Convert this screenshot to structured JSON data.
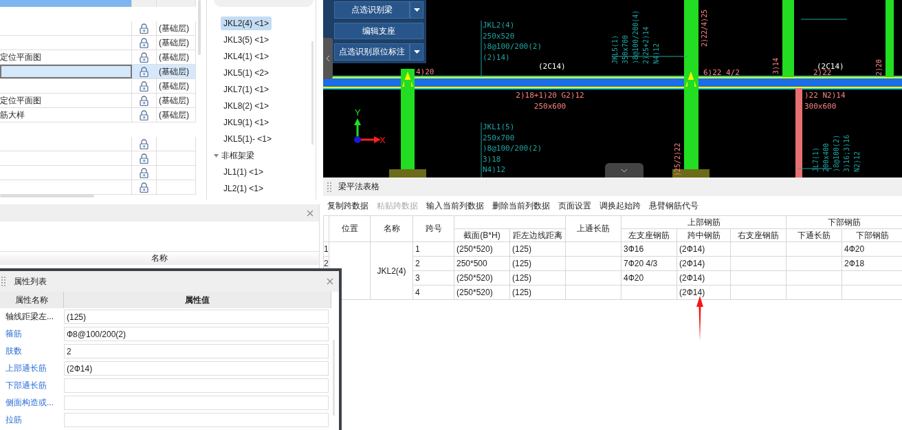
{
  "layer_table": {
    "rows": [
      {
        "kind": "spacer"
      },
      {
        "kind": "entry",
        "floor": "(基础层)",
        "selected": false
      },
      {
        "kind": "entry",
        "floor": "(基础层)",
        "selected": false
      },
      {
        "kind": "entry",
        "name": "定位平面图",
        "floor": "(基础层)",
        "selected": false
      },
      {
        "kind": "entry",
        "floor": "(基础层)",
        "selected": true
      },
      {
        "kind": "entry",
        "floor": "(基础层)",
        "selected": false
      },
      {
        "kind": "entry",
        "name": "定位平面图",
        "floor": "(基础层)",
        "selected": false
      },
      {
        "kind": "entry",
        "name": "筋大样",
        "floor": "(基础层)",
        "selected": false
      },
      {
        "kind": "spacer"
      },
      {
        "kind": "entry",
        "selected": false
      },
      {
        "kind": "entry",
        "selected": false
      },
      {
        "kind": "entry",
        "selected": false
      },
      {
        "kind": "entry",
        "selected": false
      }
    ]
  },
  "component_tree": [
    {
      "kind": "item",
      "label": "JKL2(4) <1>",
      "selected": true
    },
    {
      "kind": "item",
      "label": "JKL3(5) <1>",
      "selected": false
    },
    {
      "kind": "item",
      "label": "JKL4(1) <1>",
      "selected": false
    },
    {
      "kind": "item",
      "label": "JKL5(1) <2>",
      "selected": false
    },
    {
      "kind": "item",
      "label": "JKL7(1) <1>",
      "selected": false
    },
    {
      "kind": "item",
      "label": "JKL8(2) <1>",
      "selected": false
    },
    {
      "kind": "item",
      "label": "JKL9(1) <1>",
      "selected": false
    },
    {
      "kind": "item",
      "label": "JKL5(1)- <1>",
      "selected": false
    },
    {
      "kind": "group",
      "label": "非框架梁",
      "expanded": true,
      "selected": false,
      "children": [
        {
          "kind": "item",
          "label": "JL1(1) <1>",
          "selected": false
        },
        {
          "kind": "item",
          "label": "JL2(1) <1>",
          "selected": false
        }
      ]
    }
  ],
  "lower_panel": {
    "column": "名称"
  },
  "cad": {
    "toolbar": [
      {
        "label": "点选识别梁",
        "dropdown": true
      },
      {
        "label": "编辑支座",
        "dropdown": false
      },
      {
        "label": "点选识别原位标注",
        "dropdown": true
      }
    ],
    "axis": {
      "x": "X",
      "y": "Y"
    },
    "labels": [
      {
        "lines": [
          "JKL2(4)",
          "250x520",
          ")8@100/200(2)",
          "(2)14)"
        ],
        "color": "#1fa5a5",
        "rotated": false
      },
      {
        "lines": [
          "(2C14)"
        ],
        "color": "#ffffff",
        "rotated": false
      },
      {
        "lines": [
          "4)20"
        ],
        "color": "#ff8080",
        "rotated": false
      },
      {
        "lines": [
          "2)18+1)20 G2)12",
          "250x600"
        ],
        "color": "#ff8080",
        "rotated": false
      },
      {
        "lines": [
          "JKL5(1)",
          "350x700",
          ")8@100/200(4)",
          "2)25+2)14",
          "N4)12"
        ],
        "color": "#1fa5a5",
        "rotated": true
      },
      {
        "lines": [
          "2)22/4)25"
        ],
        "color": "#ff8080",
        "rotated": true
      },
      {
        "lines": [
          "6)22 4/2"
        ],
        "color": "#ff8080",
        "rotated": false
      },
      {
        "lines": [
          "3)14"
        ],
        "color": "#ff8080",
        "rotated": true
      },
      {
        "lines": [
          "(2C14)"
        ],
        "color": "#ffffff",
        "rotated": false
      },
      {
        "lines": [
          "2)22"
        ],
        "color": "#ff8080",
        "rotated": false
      },
      {
        "lines": [
          "2)20"
        ],
        "color": "#ff8080",
        "rotated": true
      },
      {
        "lines": [
          ")22 N2)14",
          "300x600"
        ],
        "color": "#ff8080",
        "rotated": false
      },
      {
        "lines": [
          "JKL1(5)",
          "250x700",
          ")8@100/200(2)",
          "3)18",
          "N4)12"
        ],
        "color": "#1fa5a5",
        "rotated": false
      },
      {
        "lines": [
          ")25/2)22"
        ],
        "color": "#ff8080",
        "rotated": true
      },
      {
        "lines": [
          "JL7(1)",
          "200x400",
          ")8@100(2)",
          "3)16;3)16",
          "N2)12"
        ],
        "color": "#1fa5a5",
        "rotated": true
      }
    ]
  },
  "beam_table": {
    "title": "梁平法表格",
    "toolbar": [
      {
        "label": "复制跨数据",
        "disabled": false
      },
      {
        "label": "粘贴跨数据",
        "disabled": true
      },
      {
        "label": "输入当前列数据",
        "disabled": false
      },
      {
        "label": "删除当前列数据",
        "disabled": false
      },
      {
        "label": "页面设置",
        "disabled": false
      },
      {
        "label": "调换起始跨",
        "disabled": false
      },
      {
        "label": "悬臂钢筋代号",
        "disabled": false
      }
    ],
    "columns": [
      {
        "label": "位置"
      },
      {
        "label": "名称"
      },
      {
        "label": "跨号"
      },
      {
        "children": [
          {
            "label": "截面(B*H)"
          },
          {
            "label": "距左边线距离"
          }
        ]
      },
      {
        "label": "上通长筋"
      },
      {
        "label": "上部钢筋",
        "children": [
          {
            "label": "左支座钢筋"
          },
          {
            "label": "跨中钢筋"
          },
          {
            "label": "右支座钢筋"
          }
        ]
      },
      {
        "label": "下部钢筋",
        "children": [
          {
            "label": "下通长筋"
          },
          {
            "label": "下部钢筋"
          }
        ]
      }
    ],
    "beam_name": "JKL2(4)",
    "rows": [
      {
        "row_number": "1",
        "span": "1",
        "section": "(250*520)",
        "offset": "(125)",
        "left_support": "3Ф16",
        "mid_span": "(2Ф14)",
        "bottom": "4Ф20"
      },
      {
        "row_number": "2",
        "span": "2",
        "section": "250*500",
        "offset": "(125)",
        "left_support": "7Ф20 4/3",
        "mid_span": "(2Ф14)",
        "bottom": "2Ф18"
      },
      {
        "span": "3",
        "section": "(250*520)",
        "offset": "(125)",
        "left_support": "4Ф20",
        "mid_span": "(2Ф14)"
      },
      {
        "span": "4",
        "section": "(250*520)",
        "offset": "(125)",
        "mid_span": "(2Ф14)"
      }
    ]
  },
  "property_panel": {
    "title": "属性列表",
    "columns": [
      "属性名称",
      "属性值"
    ],
    "rows": [
      {
        "name": "轴线距梁左...",
        "value": "(125)",
        "link": false
      },
      {
        "name": "箍筋",
        "value": "Ф8@100/200(2)",
        "link": true
      },
      {
        "name": "肢数",
        "value": "2",
        "link": true
      },
      {
        "name": "上部通长筋",
        "value": "(2Ф14)",
        "link": true
      },
      {
        "name": "下部通长筋",
        "link": true
      },
      {
        "name": "侧面构造或...",
        "link": true
      },
      {
        "name": "拉筋",
        "link": true
      }
    ]
  }
}
